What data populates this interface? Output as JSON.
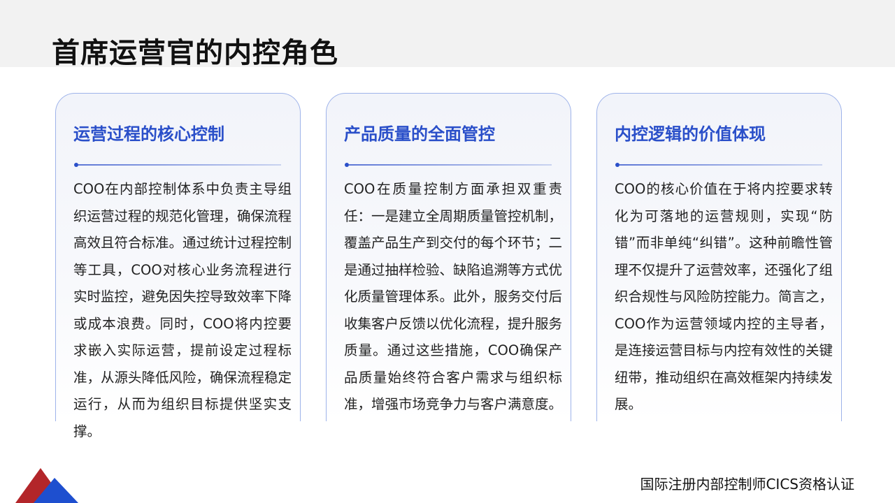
{
  "page": {
    "title": "首席运营官的内控角色",
    "footer": "国际注册内部控制师CICS资格认证"
  },
  "colors": {
    "accent": "#2a4fc9",
    "card_border": "#9eb3ea",
    "top_band": "#f2f2f2",
    "logo_red": "#b3262a",
    "logo_blue": "#1e4fcf"
  },
  "cards": [
    {
      "title": "运营过程的核心控制",
      "body": "COO在内部控制体系中负责主导组织运营过程的规范化管理，确保流程高效且符合标准。通过统计过程控制等工具，COO对核心业务流程进行实时监控，避免因失控导致效率下降或成本浪费。同时，COO将内控要求嵌入实际运营，提前设定过程标准，从源头降低风险，确保流程稳定运行，从而为组织目标提供坚实支撑。"
    },
    {
      "title": "产品质量的全面管控",
      "body": "COO在质量控制方面承担双重责任：一是建立全周期质量管控机制，覆盖产品生产到交付的每个环节；二是通过抽样检验、缺陷追溯等方式优化质量管理体系。此外，服务交付后收集客户反馈以优化流程，提升服务质量。通过这些措施，COO确保产品质量始终符合客户需求与组织标准，增强市场竞争力与客户满意度。"
    },
    {
      "title": "内控逻辑的价值体现",
      "body": "COO的核心价值在于将内控要求转化为可落地的运营规则，实现“防错”而非单纯“纠错”。这种前瞻性管理不仅提升了运营效率，还强化了组织合规性与风险防控能力。简言之，COO作为运营领域内控的主导者，是连接运营目标与内控有效性的关键纽带，推动组织在高效框架内持续发展。"
    }
  ]
}
